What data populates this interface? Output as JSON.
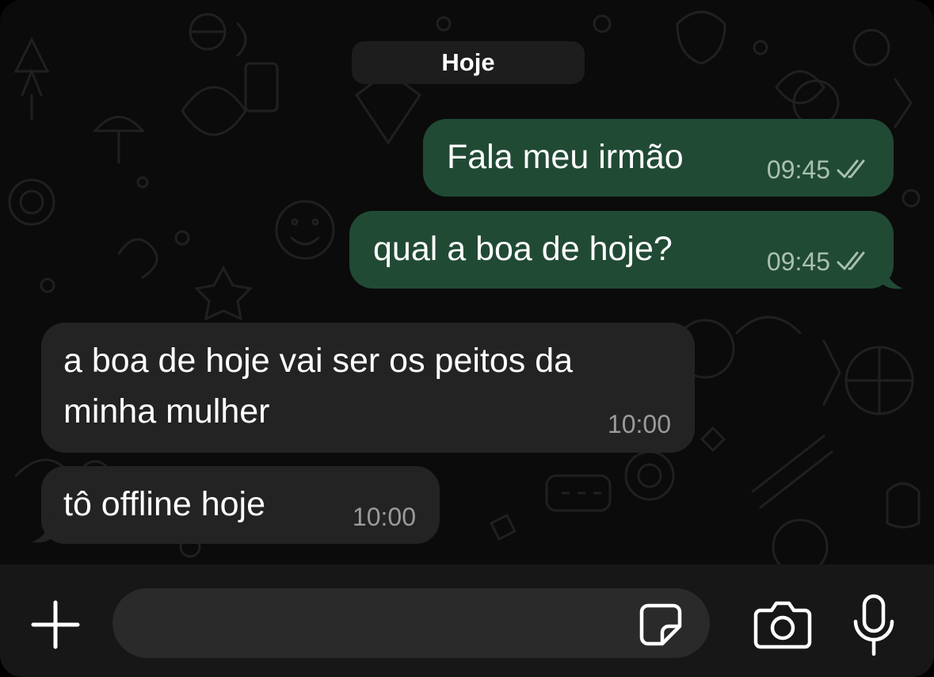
{
  "chat": {
    "date_separator": "Hoje",
    "messages": [
      {
        "direction": "outgoing",
        "text": "Fala meu irmão",
        "time": "09:45",
        "status": "read"
      },
      {
        "direction": "outgoing",
        "text": "qual a boa de hoje?",
        "time": "09:45",
        "status": "read"
      },
      {
        "direction": "incoming",
        "line1": "a boa de hoje vai ser os peitos da",
        "line2": "minha mulher",
        "time": "10:00"
      },
      {
        "direction": "incoming",
        "text": "tô offline hoje",
        "time": "10:00"
      }
    ]
  },
  "composer": {
    "input_value": "",
    "input_placeholder": "",
    "icons": [
      "plus-icon",
      "sticker-icon",
      "camera-icon",
      "microphone-icon"
    ]
  },
  "colors": {
    "outgoing_bubble": "#214a35",
    "incoming_bubble": "#232323",
    "background": "#0b0b0b",
    "read_ticks": "#a9c0b3"
  }
}
